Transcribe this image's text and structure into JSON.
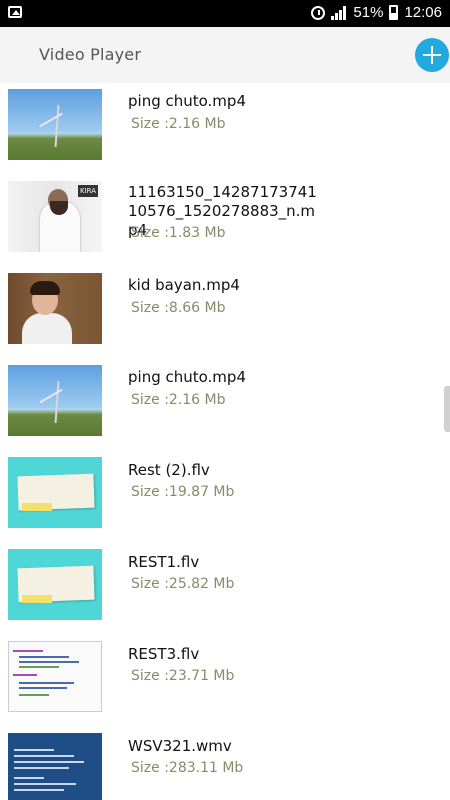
{
  "status": {
    "battery": "51%",
    "time": "12:06"
  },
  "app": {
    "title": "Video Player"
  },
  "videos": [
    {
      "name": "ping chuto.mp4",
      "size": "Size :2.16 Mb",
      "thumb": "tower"
    },
    {
      "name": "11163150_1428717374110576_1520278883_n.mp4",
      "size": "Size :1.83 Mb",
      "thumb": "sheikh"
    },
    {
      "name": "kid bayan.mp4",
      "size": "Size :8.66 Mb",
      "thumb": "kid"
    },
    {
      "name": "ping chuto.mp4",
      "size": "Size :2.16 Mb",
      "thumb": "tower"
    },
    {
      "name": "Rest (2).flv",
      "size": "Size :19.87 Mb",
      "thumb": "paper"
    },
    {
      "name": "REST1.flv",
      "size": "Size :25.82 Mb",
      "thumb": "paper"
    },
    {
      "name": "REST3.flv",
      "size": "Size :23.71 Mb",
      "thumb": "code"
    },
    {
      "name": "WSV321.wmv",
      "size": "Size :283.11 Mb",
      "thumb": "slide"
    }
  ]
}
